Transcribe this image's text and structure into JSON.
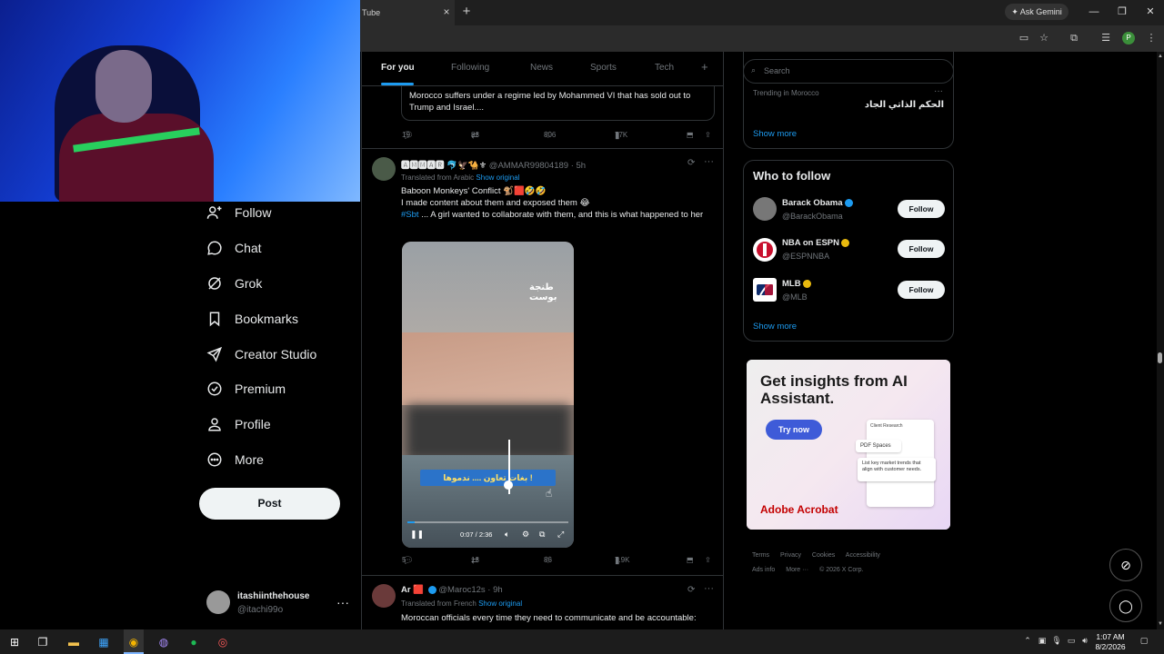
{
  "browser": {
    "tab_title": "Tube",
    "tab_close": "×",
    "new_tab": "+",
    "ask_gemini": "Ask Gemini",
    "profile_initial": "P",
    "window": {
      "minimize": "—",
      "restore": "❐",
      "close": "✕"
    }
  },
  "sidebar": {
    "items": [
      {
        "label": "Follow",
        "icon": "person-plus-icon"
      },
      {
        "label": "Chat",
        "icon": "chat-bubble-icon"
      },
      {
        "label": "Grok",
        "icon": "grok-icon"
      },
      {
        "label": "Bookmarks",
        "icon": "bookmark-icon"
      },
      {
        "label": "Creator Studio",
        "icon": "rocket-icon"
      },
      {
        "label": "Premium",
        "icon": "verified-check-icon"
      },
      {
        "label": "Profile",
        "icon": "person-icon"
      },
      {
        "label": "More",
        "icon": "more-circle-icon"
      }
    ],
    "post_label": "Post",
    "user": {
      "name": "itashiinthehouse",
      "handle": "@itachi99o",
      "more": "···"
    }
  },
  "feed": {
    "tabs": [
      "For you",
      "Following",
      "News",
      "Sports",
      "Tech"
    ],
    "add_tab": "+",
    "quote_text": "Morocco suffers under a regime led by Mohammed VI that has sold out to Trump and Israel....",
    "post0_actions": {
      "replies": "19",
      "reposts": "83",
      "likes": "806",
      "views": "77K"
    },
    "post1": {
      "name": "🅰🅼🅼🅰🆁 🐬🦅🐪⚜",
      "handle": "@AMMAR99804189 · 5h",
      "translated_prefix": "Translated from Arabic",
      "show_original": "Show original",
      "line1": "Baboon Monkeys' Conflict 🐒🟥🤣🤣",
      "line2": "I made content about them and exposed them 😂",
      "hashtag": "#Sbt",
      "line3_rest": " ... A girl wanted to collaborate with them, and this is what happened to her",
      "video": {
        "caption": "بغات تعاون .... ندموها !",
        "watermark": "طنجة بوست",
        "time": "0:07 / 2:36",
        "progress": 0.045
      },
      "actions": {
        "replies": "5",
        "reposts": "13",
        "likes": "86",
        "views": "7.9K"
      }
    },
    "post2": {
      "name": "Ar 🟥",
      "handle": "@Maroc12s · 9h",
      "translated_prefix": "Translated from French",
      "show_original": "Show original",
      "text": "Moroccan officials every time they need to communicate and be accountable:"
    }
  },
  "right": {
    "search_placeholder": "Search",
    "trending_loc": "Trending in Morocco",
    "trending_name": "الحكم الذاتي الجاد",
    "show_more": "Show more",
    "wtf_title": "Who to follow",
    "follow_label": "Follow",
    "wtf": [
      {
        "name": "Barack Obama",
        "handle": "@BarackObama",
        "color": "#888888",
        "badge": "#1d9bf0"
      },
      {
        "name": "NBA on ESPN",
        "handle": "@ESPNNBA",
        "color": "#ffffff",
        "badge": "#e8b90e"
      },
      {
        "name": "MLB",
        "handle": "@MLB",
        "color": "#ffffff",
        "badge": "#e8b90e"
      }
    ],
    "wtf_show_more": "Show more",
    "ad": {
      "title": "Get insights from AI Assistant.",
      "cta": "Try now",
      "card1": "Client Research",
      "card2": "PDF Spaces",
      "card3": "List key market trends that align with customer needs.",
      "brand": "Adobe Acrobat"
    },
    "footer": [
      "Terms",
      "Privacy",
      "Cookies",
      "Accessibility",
      "Ads info",
      "More ···",
      "© 2026 X Corp."
    ]
  },
  "taskbar": {
    "time": "1:07 AM",
    "date": "8/2/2026"
  }
}
